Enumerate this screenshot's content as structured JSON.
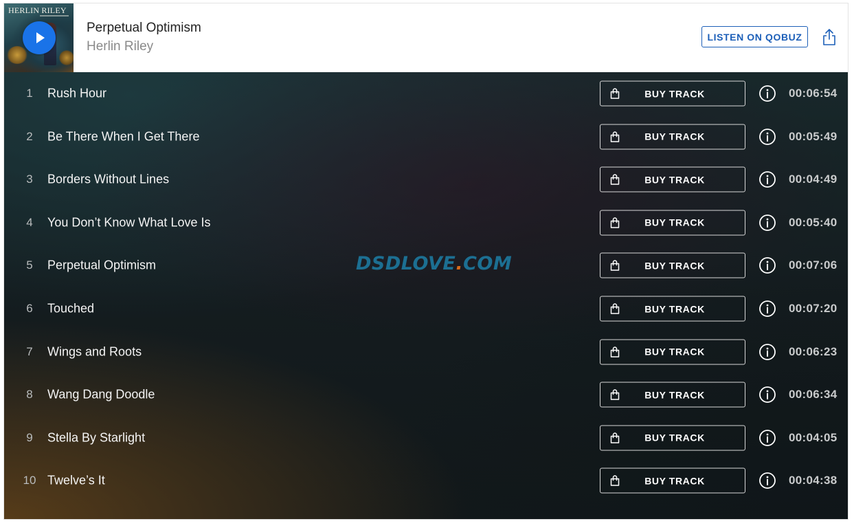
{
  "header": {
    "cover": {
      "text": "HERLIN RILEY"
    },
    "album_title": "Perpetual Optimism",
    "artist": "Herlin Riley",
    "listen_label": "LISTEN ON QOBUZ"
  },
  "tracks": [
    {
      "number": "1",
      "title": "Rush Hour",
      "buy_label": "BUY TRACK",
      "duration": "00:06:54"
    },
    {
      "number": "2",
      "title": "Be There When I Get There",
      "buy_label": "BUY TRACK",
      "duration": "00:05:49"
    },
    {
      "number": "3",
      "title": "Borders Without Lines",
      "buy_label": "BUY TRACK",
      "duration": "00:04:49"
    },
    {
      "number": "4",
      "title": "You Don’t Know What Love Is",
      "buy_label": "BUY TRACK",
      "duration": "00:05:40"
    },
    {
      "number": "5",
      "title": "Perpetual Optimism",
      "buy_label": "BUY TRACK",
      "duration": "00:07:06"
    },
    {
      "number": "6",
      "title": "Touched",
      "buy_label": "BUY TRACK",
      "duration": "00:07:20"
    },
    {
      "number": "7",
      "title": "Wings and Roots",
      "buy_label": "BUY TRACK",
      "duration": "00:06:23"
    },
    {
      "number": "8",
      "title": "Wang Dang Doodle",
      "buy_label": "BUY TRACK",
      "duration": "00:06:34"
    },
    {
      "number": "9",
      "title": "Stella By Starlight",
      "buy_label": "BUY TRACK",
      "duration": "00:04:05"
    },
    {
      "number": "10",
      "title": "Twelve’s It",
      "buy_label": "BUY TRACK",
      "duration": "00:04:38"
    }
  ],
  "watermark": {
    "main": "DSDLOVE",
    "dot": ".",
    "suffix": "COM"
  },
  "icons": {
    "play": "play-icon",
    "share": "share-icon",
    "buy": "shopping-bag-icon",
    "info": "info-icon"
  },
  "colors": {
    "accent": "#1a73e8",
    "qobuz_blue": "#1c5fb8",
    "watermark_blue": "#1c6f92",
    "watermark_orange": "#d96a1a"
  }
}
